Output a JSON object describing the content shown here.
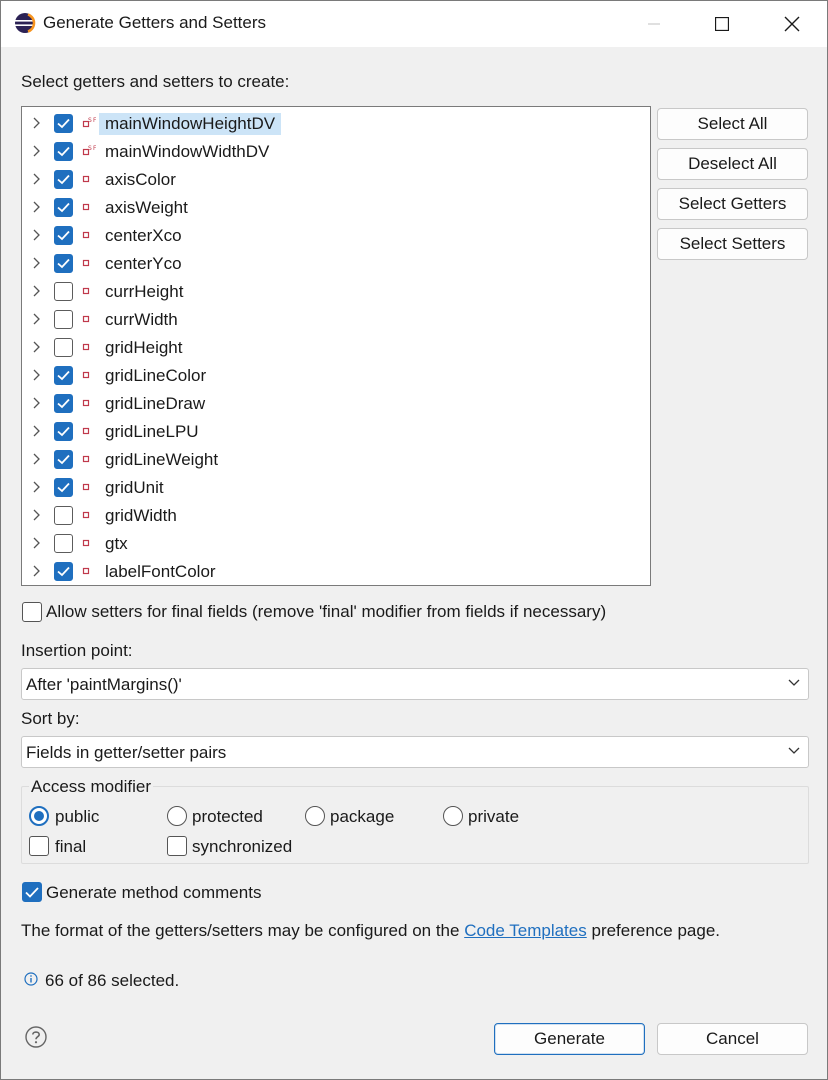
{
  "window": {
    "title": "Generate Getters and Setters"
  },
  "prompt": "Select getters and setters to create:",
  "fields": [
    {
      "name": "mainWindowHeightDV",
      "checked": true,
      "icon": "static-final-field-icon",
      "selected": true
    },
    {
      "name": "mainWindowWidthDV",
      "checked": true,
      "icon": "static-final-field-icon",
      "selected": false
    },
    {
      "name": "axisColor",
      "checked": true,
      "icon": "private-field-icon",
      "selected": false
    },
    {
      "name": "axisWeight",
      "checked": true,
      "icon": "private-field-icon",
      "selected": false
    },
    {
      "name": "centerXco",
      "checked": true,
      "icon": "private-field-icon",
      "selected": false
    },
    {
      "name": "centerYco",
      "checked": true,
      "icon": "private-field-icon",
      "selected": false
    },
    {
      "name": "currHeight",
      "checked": false,
      "icon": "private-field-icon",
      "selected": false
    },
    {
      "name": "currWidth",
      "checked": false,
      "icon": "private-field-icon",
      "selected": false
    },
    {
      "name": "gridHeight",
      "checked": false,
      "icon": "private-field-icon",
      "selected": false
    },
    {
      "name": "gridLineColor",
      "checked": true,
      "icon": "private-field-icon",
      "selected": false
    },
    {
      "name": "gridLineDraw",
      "checked": true,
      "icon": "private-field-icon",
      "selected": false
    },
    {
      "name": "gridLineLPU",
      "checked": true,
      "icon": "private-field-icon",
      "selected": false
    },
    {
      "name": "gridLineWeight",
      "checked": true,
      "icon": "private-field-icon",
      "selected": false
    },
    {
      "name": "gridUnit",
      "checked": true,
      "icon": "private-field-icon",
      "selected": false
    },
    {
      "name": "gridWidth",
      "checked": false,
      "icon": "private-field-icon",
      "selected": false
    },
    {
      "name": "gtx",
      "checked": false,
      "icon": "private-field-icon",
      "selected": false
    },
    {
      "name": "labelFontColor",
      "checked": true,
      "icon": "private-field-icon",
      "selected": false
    }
  ],
  "side_buttons": {
    "select_all": "Select All",
    "deselect_all": "Deselect All",
    "select_getters": "Select Getters",
    "select_setters": "Select Setters"
  },
  "allow_final": {
    "label": "Allow setters for final fields (remove 'final' modifier from fields if necessary)",
    "checked": false
  },
  "insertion": {
    "label": "Insertion point:",
    "value": "After 'paintMargins()'"
  },
  "sort": {
    "label": "Sort by:",
    "value": "Fields in getter/setter pairs"
  },
  "access": {
    "title": "Access modifier",
    "public": "public",
    "protected": "protected",
    "package": "package",
    "private": "private",
    "selected": "public",
    "final": "final",
    "final_checked": false,
    "synchronized": "synchronized",
    "synchronized_checked": false
  },
  "comments": {
    "label": "Generate method comments",
    "checked": true
  },
  "format_note": {
    "before": "The format of the getters/setters may be configured on the",
    "link": "Code Templates",
    "after": "preference page."
  },
  "status": "66 of 86 selected.",
  "footer": {
    "generate": "Generate",
    "cancel": "Cancel"
  },
  "colors": {
    "accent": "#1f6fbf",
    "selection": "#cce4f7",
    "field_icon": "#c0394b"
  }
}
